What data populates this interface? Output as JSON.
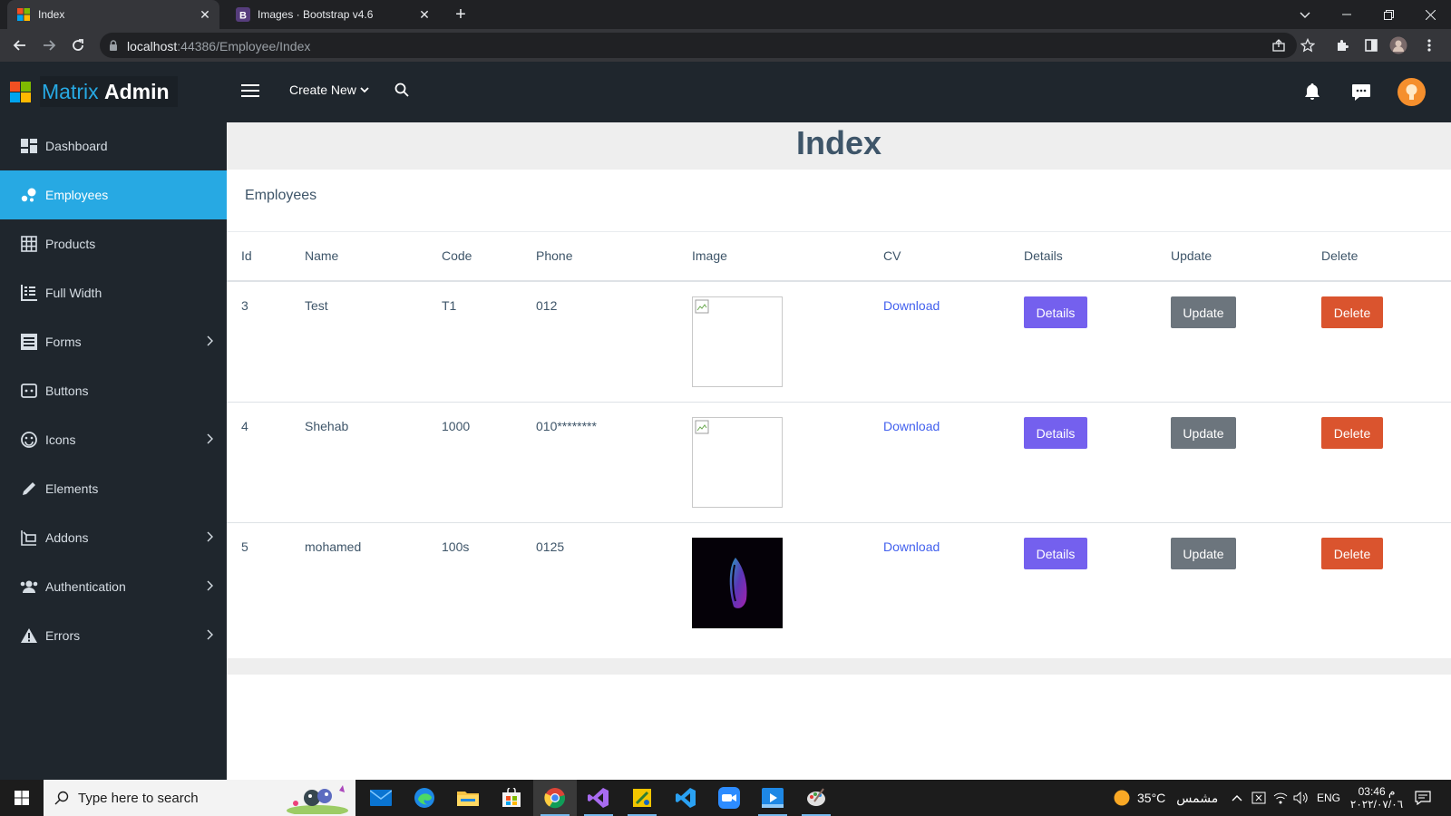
{
  "browser": {
    "tabs": [
      {
        "title": "Index",
        "active": true
      },
      {
        "title": "Images · Bootstrap v4.6",
        "active": false
      }
    ],
    "url_host": "localhost",
    "url_path": ":44386/Employee/Index"
  },
  "brand": {
    "matrix": "Matrix",
    "admin": "Admin"
  },
  "sidebar": {
    "items": [
      {
        "label": "Dashboard",
        "icon": "dashboard-icon",
        "has_submenu": false,
        "active": false
      },
      {
        "label": "Employees",
        "icon": "employees-icon",
        "has_submenu": false,
        "active": true
      },
      {
        "label": "Products",
        "icon": "grid-icon",
        "has_submenu": false,
        "active": false
      },
      {
        "label": "Full Width",
        "icon": "full-width-icon",
        "has_submenu": false,
        "active": false
      },
      {
        "label": "Forms",
        "icon": "forms-icon",
        "has_submenu": true,
        "active": false
      },
      {
        "label": "Buttons",
        "icon": "buttons-icon",
        "has_submenu": false,
        "active": false
      },
      {
        "label": "Icons",
        "icon": "smiley-icon",
        "has_submenu": true,
        "active": false
      },
      {
        "label": "Elements",
        "icon": "pencil-icon",
        "has_submenu": false,
        "active": false
      },
      {
        "label": "Addons",
        "icon": "addons-icon",
        "has_submenu": true,
        "active": false
      },
      {
        "label": "Authentication",
        "icon": "users-icon",
        "has_submenu": true,
        "active": false
      },
      {
        "label": "Errors",
        "icon": "warning-icon",
        "has_submenu": true,
        "active": false
      }
    ]
  },
  "topbar": {
    "create_new": "Create New"
  },
  "main": {
    "page_title": "Index",
    "card_title": "Employees",
    "columns": [
      "Id",
      "Name",
      "Code",
      "Phone",
      "Image",
      "CV",
      "Details",
      "Update",
      "Delete"
    ],
    "rows": [
      {
        "id": "3",
        "name": "Test",
        "code": "T1",
        "phone": "012",
        "image": "broken",
        "cv": "Download",
        "details": "Details",
        "update": "Update",
        "delete": "Delete"
      },
      {
        "id": "4",
        "name": "Shehab",
        "code": "1000",
        "phone": "010********",
        "image": "broken",
        "cv": "Download",
        "details": "Details",
        "update": "Update",
        "delete": "Delete"
      },
      {
        "id": "5",
        "name": "mohamed",
        "code": "100s",
        "phone": "0125",
        "image": "photo",
        "cv": "Download",
        "details": "Details",
        "update": "Update",
        "delete": "Delete"
      }
    ]
  },
  "taskbar": {
    "search_placeholder": "Type here to search",
    "weather_temp": "35°C",
    "weather_text": "مشمس",
    "language": "ENG",
    "time": "03:46 م",
    "date": "٢٠٢٢/٠٧/٠٦"
  },
  "colors": {
    "sidebar_bg": "#1f262d",
    "sidebar_active": "#27a9e3",
    "details_btn": "#7460ee",
    "update_btn": "#6c757d",
    "delete_btn": "#da542e",
    "link": "#4361ee"
  }
}
